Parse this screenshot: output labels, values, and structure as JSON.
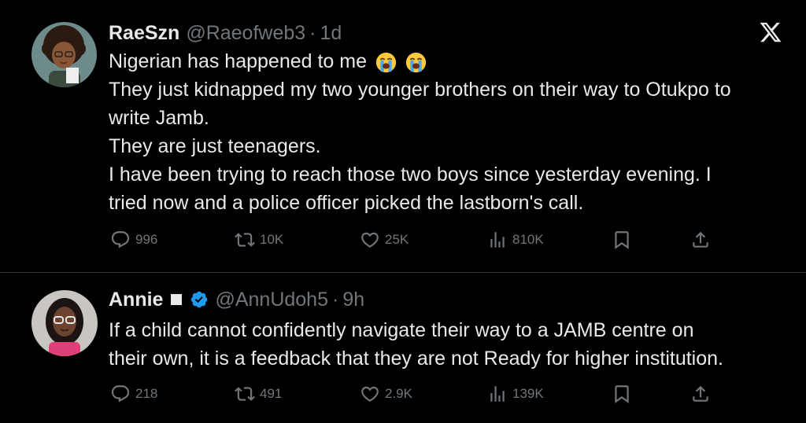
{
  "tweets": [
    {
      "name": "RaeSzn",
      "handle": "@Raeofweb3",
      "separator": "·",
      "time": "1d",
      "lines": [
        "Nigerian has happened to me",
        "They just kidnapped my two younger brothers on their way to Otukpo to",
        "write Jamb.",
        "They are just teenagers.",
        "I have been trying to reach those two boys since yesterday evening. I",
        "tried now and a police officer picked the lastborn's call."
      ],
      "emoji": [
        "loudly-crying-face",
        "loudly-crying-face"
      ],
      "replies": "996",
      "reposts": "10K",
      "likes": "25K",
      "views": "810K"
    },
    {
      "name": "Annie",
      "handle": "@AnnUdoh5",
      "separator": "·",
      "time": "9h",
      "verified": true,
      "lines": [
        "If a child cannot confidently navigate their way to a JAMB centre on",
        "their own, it is a feedback that they are not Ready for higher institution."
      ],
      "replies": "218",
      "reposts": "491",
      "likes": "2.9K",
      "views": "139K"
    }
  ],
  "icons": [
    "x-logo-icon",
    "reply-icon",
    "repost-icon",
    "like-icon",
    "views-icon",
    "bookmark-icon",
    "share-icon",
    "verified-badge-icon"
  ],
  "colors": {
    "background": "#000000",
    "text": "#e7e9ea",
    "muted": "#71767b",
    "verified": "#1d9bf0"
  }
}
